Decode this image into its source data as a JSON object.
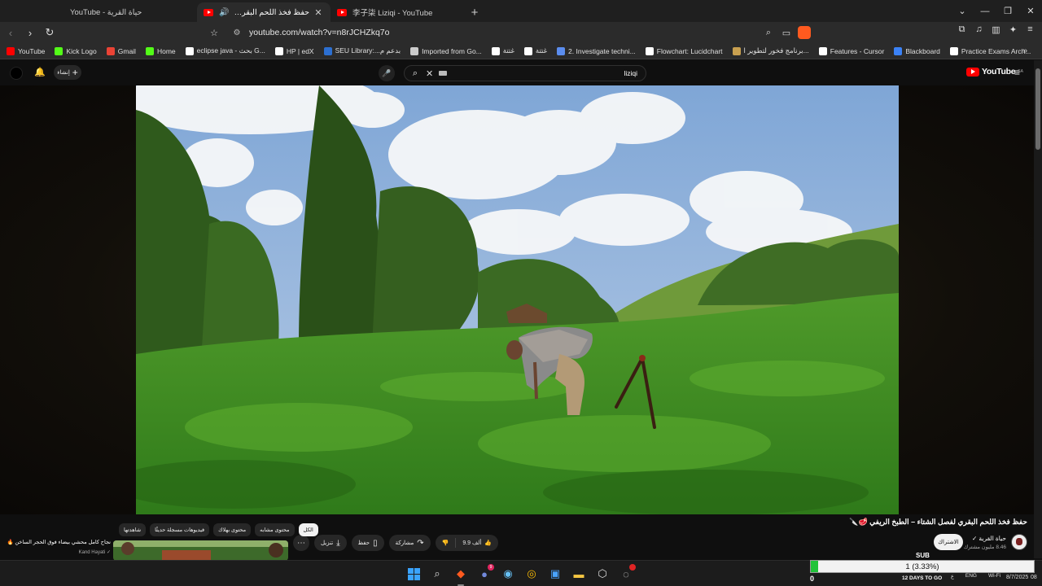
{
  "browser": {
    "tabs": [
      {
        "title": "YouTube - حياة القرية",
        "active": false
      },
      {
        "title": "حفظ فخذ اللحم البقري لفصل ال",
        "active": true,
        "audio": true
      },
      {
        "title": "李子柒 Liziqi - YouTube",
        "active": false
      }
    ],
    "new_tab": "+",
    "url": "youtube.com/watch?v=n8rJCHZkq7o"
  },
  "bookmarks": [
    {
      "label": "YouTube",
      "icon": "youtube-icon",
      "color": "#ff0000"
    },
    {
      "label": "Kick Logo",
      "icon": "kick-icon",
      "color": "#53fc18"
    },
    {
      "label": "Gmail",
      "icon": "gmail-icon",
      "color": "#ea4335"
    },
    {
      "label": "Home",
      "icon": "kick-icon",
      "color": "#53fc18"
    },
    {
      "label": "eclipse java - بحث G...",
      "icon": "google-icon",
      "color": "#ffffff"
    },
    {
      "label": "HP | edX",
      "icon": "edx-icon",
      "color": "#ffffff"
    },
    {
      "label": "SEU Library:...بدعم م",
      "icon": "library-icon",
      "color": "#2c6fd1"
    },
    {
      "label": "Imported from Go...",
      "icon": "folder-icon",
      "color": "#cccccc"
    },
    {
      "label": "غتتة",
      "icon": "sheet-icon",
      "color": "#ffffff"
    },
    {
      "label": "غتتة",
      "icon": "sheet-icon",
      "color": "#ffffff"
    },
    {
      "label": "2. Investigate techni...",
      "icon": "diamond-icon",
      "color": "#5b8def"
    },
    {
      "label": "Flowchart: Lucidchart",
      "icon": "lucid-icon",
      "color": "#ffffff"
    },
    {
      "label": "برنامج فخور لتطوير ا...",
      "icon": "leaf-icon",
      "color": "#c8a050"
    },
    {
      "label": "Features - Cursor",
      "icon": "cursor-icon",
      "color": "#ffffff"
    },
    {
      "label": "Blackboard",
      "icon": "blackboard-icon",
      "color": "#3b82f6"
    },
    {
      "label": "Practice Exams Arch...",
      "icon": "exam-icon",
      "color": "#ffffff"
    }
  ],
  "masthead": {
    "create_label": "إنشاء",
    "search_value": "liziqi",
    "logo_text": "YouTube",
    "logo_region": "SA"
  },
  "video": {
    "title": "حفظ فخذ اللحم البقري لفصل الشتاء – الطبخ الريفي 🥩🔪",
    "channel_name": "حياة القرية ✓",
    "channel_subs": "8.46 مليون مشترك",
    "subscribe_label": "الاشتراك",
    "likes": "9.9 ألف",
    "share_label": "مشاركة",
    "save_label": "حفظ",
    "download_label": "تنزيل",
    "more_label": "⋯"
  },
  "chips": [
    {
      "label": "الكل",
      "active": true
    },
    {
      "label": "محتوى مشابه",
      "active": false
    },
    {
      "label": "محتوى بهلاك",
      "active": false
    },
    {
      "label": "فيديوهات مسجلة حديثًا",
      "active": false
    },
    {
      "label": "شاهدتها",
      "active": false
    }
  ],
  "recommendation": {
    "title": "نجاح كامل محشي بيضاء فوق الحجر الساخن 🔥🌿",
    "channel": "Kand Hayati ✓"
  },
  "taskbar": {
    "progress": {
      "percent_fill": 3.33,
      "text": "1 (3.33%)",
      "left_value": "0",
      "header": "SUB",
      "footer": "12 DAYS TO GO"
    },
    "tray": [
      "ع",
      "ENG",
      "Wi-Fi"
    ],
    "date": "8/7/2025",
    "tail": "08"
  }
}
